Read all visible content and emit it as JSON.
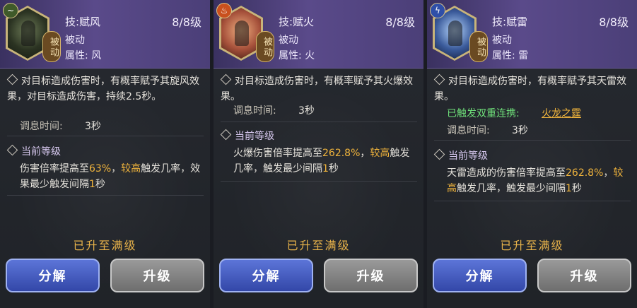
{
  "panels": [
    {
      "skill_name": "技:赋风",
      "level": "8/8级",
      "badge": "被动",
      "type": "被动",
      "attribute": "属性: 风",
      "description": "对目标造成伤害时，有概率赋予其旋风效果，对目标造成伤害，持续2.5秒。",
      "cooldown_label": "调息时间:",
      "cooldown_value": "3秒",
      "current_level_title": "当前等级",
      "current_pre": "伤害倍率提高至",
      "current_value": "63%",
      "current_sep": "，",
      "current_hl": "较高",
      "current_post": "触发几率，效果最少触发间隔",
      "current_interval": "1",
      "current_unit": "秒",
      "maxed": "已升至满级",
      "btn_decompose": "分解",
      "btn_upgrade": "升级",
      "elem_icon": "~"
    },
    {
      "skill_name": "技:赋火",
      "level": "8/8级",
      "badge": "被动",
      "type": "被动",
      "attribute": "属性: 火",
      "description": "对目标造成伤害时，有概率赋予其火爆效果。",
      "cooldown_label": "调息时间:",
      "cooldown_value": "3秒",
      "current_level_title": "当前等级",
      "current_pre": "火爆伤害倍率提高至",
      "current_value": "262.8%",
      "current_sep": "，",
      "current_hl": "较高",
      "current_post": "触发几率，触发最少间隔",
      "current_interval": "1",
      "current_unit": "秒",
      "maxed": "已升至满级",
      "btn_decompose": "分解",
      "btn_upgrade": "升级",
      "elem_icon": "♨"
    },
    {
      "skill_name": "技:赋雷",
      "level": "8/8级",
      "badge": "被动",
      "type": "被动",
      "attribute": "属性: 雷",
      "description": "对目标造成伤害时，有概率赋予其天雷效果。",
      "combo_label": "已触发双重连携:",
      "combo_link": "火龙之霆",
      "cooldown_label": "调息时间:",
      "cooldown_value": "3秒",
      "current_level_title": "当前等级",
      "current_pre": "天雷造成的伤害倍率提高至",
      "current_value": "262.8%",
      "current_sep": "，",
      "current_hl": "较高",
      "current_post": "触发几率，触发最少间隔",
      "current_interval": "1",
      "current_unit": "秒",
      "maxed": "已升至满级",
      "btn_decompose": "分解",
      "btn_upgrade": "升级",
      "elem_icon": "ϟ"
    }
  ],
  "colors": {
    "highlight": "#f0b43c",
    "combo_green": "#6fe07a",
    "header_purple": "#5a4a8a",
    "decompose_blue": "#3347a8",
    "upgrade_grey": "#6e6e6e"
  }
}
